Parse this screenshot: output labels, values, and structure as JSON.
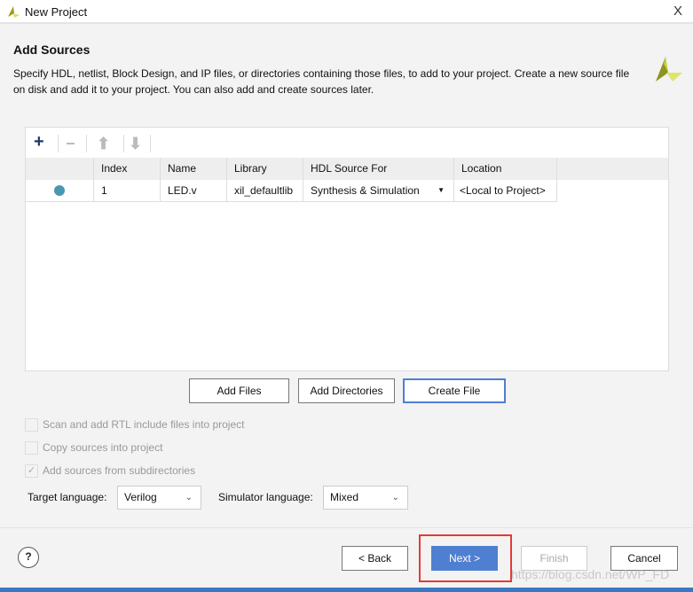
{
  "window": {
    "title": "New Project",
    "close_label": "X"
  },
  "header": {
    "title": "Add Sources",
    "description": "Specify HDL, netlist, Block Design, and IP files, or directories containing those files, to add to your project. Create a new source file on disk and add it to your project. You can also add and create sources later."
  },
  "table": {
    "columns": [
      "",
      "Index",
      "Name",
      "Library",
      "HDL Source For",
      "Location"
    ],
    "rows": [
      {
        "index": "1",
        "name": "LED.v",
        "library": "xil_defaultlib",
        "hdl_source_for": "Synthesis & Simulation",
        "location": "<Local to Project>"
      }
    ]
  },
  "buttons": {
    "add_files": "Add Files",
    "add_directories": "Add Directories",
    "create_file": "Create File",
    "back": "< Back",
    "next": "Next >",
    "finish": "Finish",
    "cancel": "Cancel",
    "help": "?"
  },
  "options": {
    "scan_rtl": {
      "label": "Scan and add RTL include files into project",
      "checked": false
    },
    "copy_sources": {
      "label": "Copy sources into project",
      "checked": false
    },
    "add_subdirs": {
      "label": "Add sources from subdirectories",
      "checked": true
    }
  },
  "target_language": {
    "label": "Target language:",
    "value": "Verilog"
  },
  "simulator_language": {
    "label": "Simulator language:",
    "value": "Mixed"
  },
  "watermark": "https://blog.csdn.net/WP_FD",
  "colors": {
    "accent": "#4f7fd1",
    "highlight": "#e53935",
    "status_dot": "#4a97b0"
  }
}
